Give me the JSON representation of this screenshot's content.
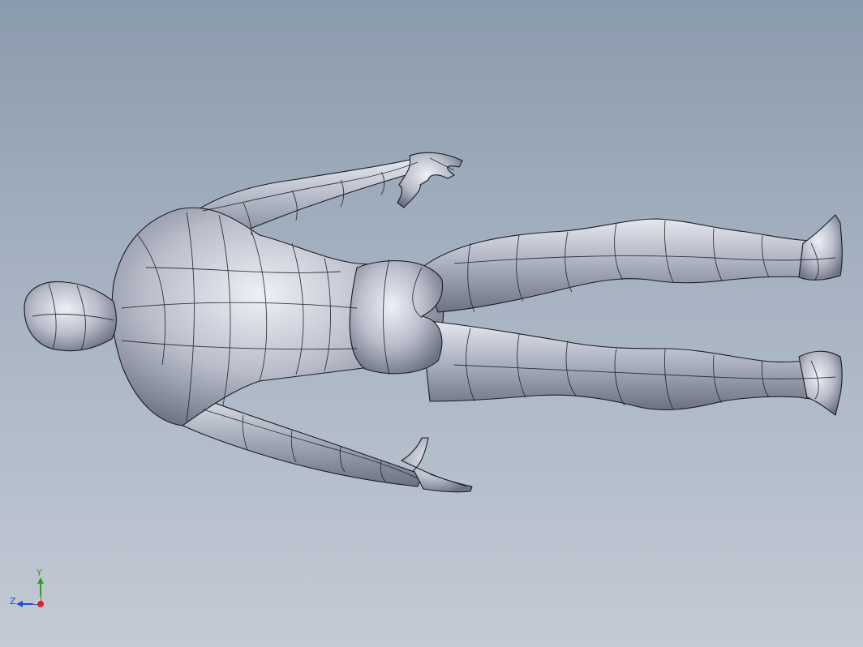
{
  "viewport": {
    "background_top": "#8a9bad",
    "background_bottom": "#c3cad5",
    "model": {
      "surface_color": "#bfc3cf",
      "wire_color": "#1a1d24"
    }
  },
  "triad": {
    "y_label": "Y",
    "z_label": "Z",
    "x_color": "#e0202a",
    "y_color": "#2ca02c",
    "z_color": "#2050d0"
  }
}
